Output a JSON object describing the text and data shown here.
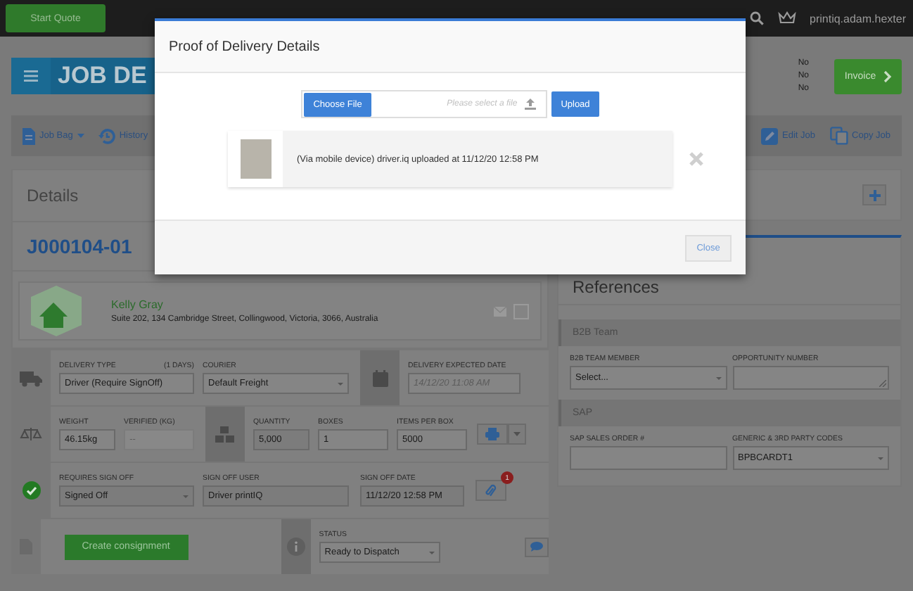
{
  "nav": {
    "start_quote": "Start Quote",
    "user": "printiq.adam.hexter"
  },
  "header": {
    "title": "JOB DE",
    "flags": [
      "No",
      "No",
      "No"
    ],
    "invoice": "Invoice"
  },
  "toolbar": {
    "left": [
      {
        "label": "Job Bag",
        "kind": "bag",
        "dropdown": true
      },
      {
        "label": "History",
        "kind": "history",
        "dropdown": false
      }
    ],
    "right": [
      {
        "label": "Edit Job",
        "kind": "edit"
      },
      {
        "label": "Copy Job",
        "kind": "copy"
      }
    ]
  },
  "details": {
    "title": "Details",
    "job_number": "J000104-01",
    "customer": {
      "name": "Kelly Gray",
      "address": "Suite 202, 134 Cambridge Street, Collingwood, Victoria, 3066, Australia",
      "checked": false
    }
  },
  "delivery": {
    "delivery_type": {
      "label": "DELIVERY TYPE",
      "note": "(1 DAYS)",
      "value": "Driver (Require SignOff)"
    },
    "courier": {
      "label": "COURIER",
      "value": "Default Freight"
    },
    "expected_date": {
      "label": "DELIVERY EXPECTED DATE",
      "placeholder": "14/12/20 11:08 AM"
    },
    "weight": {
      "label": "WEIGHT",
      "value": "46.15kg"
    },
    "verified": {
      "label": "VERIFIED (KG)",
      "placeholder": "--"
    },
    "quantity": {
      "label": "QUANTITY",
      "value": "5,000"
    },
    "boxes": {
      "label": "BOXES",
      "value": "1"
    },
    "items_per_box": {
      "label": "ITEMS PER BOX",
      "value": "5000"
    },
    "requires_sign_off": {
      "label": "REQUIRES SIGN OFF",
      "value": "Signed Off",
      "signed": true
    },
    "sign_off_user": {
      "label": "SIGN OFF USER",
      "value": "Driver printIQ"
    },
    "sign_off_date": {
      "label": "SIGN OFF DATE",
      "value": "11/12/20 12:58 PM"
    },
    "attachments_count": "1",
    "create_consignment": "Create consignment",
    "status": {
      "label": "STATUS",
      "value": "Ready to Dispatch"
    }
  },
  "references": {
    "title": "References",
    "sections": [
      {
        "title": "B2B Team",
        "fields": [
          {
            "label": "B2B TEAM MEMBER",
            "kind": "select",
            "value": "Select..."
          },
          {
            "label": "OPPORTUNITY NUMBER",
            "kind": "textarea"
          }
        ]
      },
      {
        "title": "SAP",
        "fields": [
          {
            "label": "SAP SALES ORDER #",
            "kind": "text"
          },
          {
            "label": "GENERIC & 3RD PARTY CODES",
            "kind": "select",
            "value": "BPBCARDT1"
          }
        ]
      }
    ]
  },
  "modal": {
    "title": "Proof of Delivery Details",
    "choose_file": "Choose File",
    "placeholder": "Please select a file",
    "upload": "Upload",
    "files": [
      {
        "text": "(Via mobile device) driver.iq uploaded at 11/12/20 12:58 PM"
      }
    ],
    "close": "Close"
  }
}
